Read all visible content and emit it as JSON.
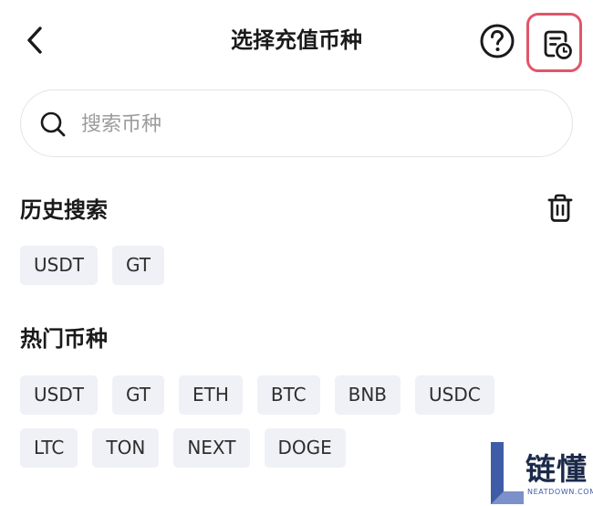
{
  "header": {
    "title": "选择充值币种",
    "back_icon": "chevron-left-icon",
    "help_icon": "question-circle-icon",
    "history_icon": "document-clock-icon",
    "history_highlight_color": "#e0566a"
  },
  "search": {
    "placeholder": "搜索币种",
    "value": "",
    "icon": "search-icon"
  },
  "history": {
    "title": "历史搜索",
    "clear_icon": "trash-icon",
    "items": [
      {
        "label": "USDT"
      },
      {
        "label": "GT"
      }
    ]
  },
  "popular": {
    "title": "热门币种",
    "rows": [
      [
        {
          "label": "USDT"
        },
        {
          "label": "GT"
        },
        {
          "label": "ETH"
        },
        {
          "label": "BTC"
        },
        {
          "label": "BNB"
        },
        {
          "label": "USDC"
        }
      ],
      [
        {
          "label": "LTC"
        },
        {
          "label": "TON"
        },
        {
          "label": "NEXT"
        },
        {
          "label": "DOGE"
        }
      ]
    ]
  },
  "colors": {
    "chip_bg": "#eff1f7",
    "text": "#1a1a1a",
    "placeholder": "#9c9c9c"
  },
  "watermark": {
    "title": "链懂",
    "subtitle": "NEATDOWN.COM"
  }
}
